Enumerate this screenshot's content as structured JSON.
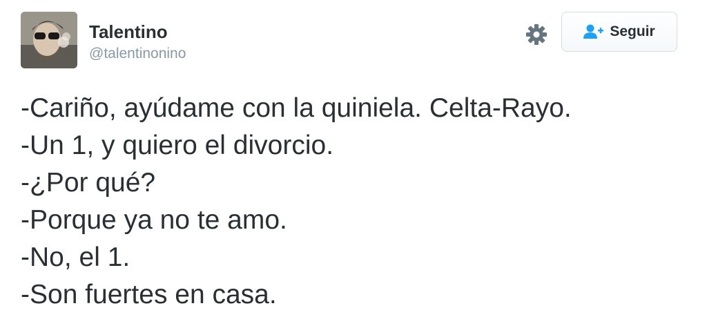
{
  "tweet": {
    "author": {
      "display_name": "Talentino",
      "handle": "@talentinonino",
      "avatar_icon": "profile-avatar"
    },
    "actions": {
      "settings_icon": "gear-icon",
      "follow_label": "Seguir",
      "follow_icon": "add-user-icon"
    },
    "text_lines": [
      "-Cariño, ayúdame con la quiniela. Celta-Rayo.",
      "-Un 1, y quiero el divorcio.",
      "-¿Por qué?",
      "-Porque ya no te amo.",
      "-No, el 1.",
      "-Son fuertes en casa."
    ]
  },
  "colors": {
    "text": "#292f33",
    "muted": "#8899a6",
    "accent": "#1da1f2",
    "gear": "#66757f"
  }
}
